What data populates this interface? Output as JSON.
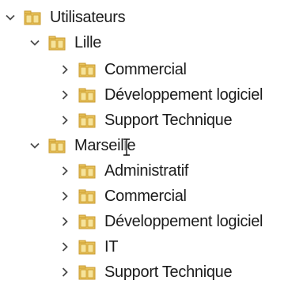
{
  "tree": {
    "root": {
      "label": "Utilisateurs",
      "expanded": true
    },
    "sites": [
      {
        "label": "Lille",
        "expanded": true,
        "children": [
          "Commercial",
          "Développement logiciel",
          "Support Technique"
        ]
      },
      {
        "label": "Marseille",
        "expanded": true,
        "children": [
          "Administratif",
          "Commercial",
          "Développement logiciel",
          "IT",
          "Support Technique"
        ]
      }
    ]
  },
  "colors": {
    "folder_body": "#e8c25a",
    "folder_dark": "#c99a2e",
    "folder_light": "#f6e39a",
    "chevron": "#4a4a4a"
  }
}
